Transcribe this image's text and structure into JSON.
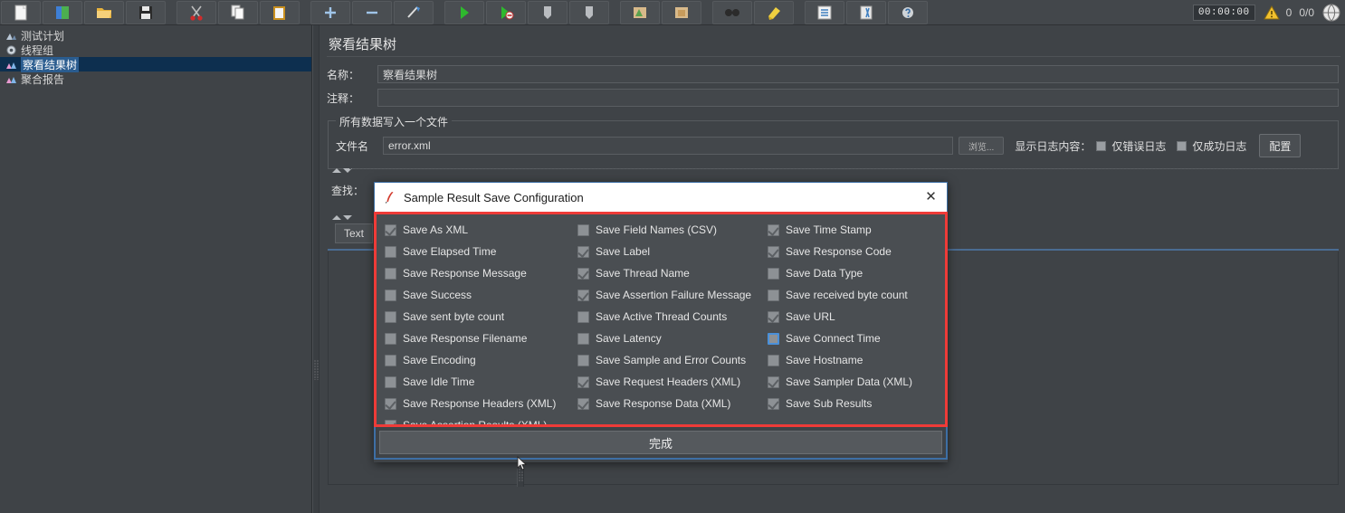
{
  "toolbar": {
    "buttons": [
      {
        "name": "new-icon",
        "label": "New"
      },
      {
        "name": "templates-icon",
        "label": "Templates"
      },
      {
        "name": "open-icon",
        "label": "Open"
      },
      {
        "name": "save-icon",
        "label": "Save"
      },
      {
        "name": "cut-icon",
        "label": "Cut"
      },
      {
        "name": "copy-icon",
        "label": "Copy"
      },
      {
        "name": "paste-icon",
        "label": "Paste"
      },
      {
        "name": "expand-all-icon",
        "label": "Expand All"
      },
      {
        "name": "collapse-all-icon",
        "label": "Collapse All"
      },
      {
        "name": "toggle-icon",
        "label": "Toggle"
      },
      {
        "name": "start-icon",
        "label": "Start"
      },
      {
        "name": "start-no-pauses-icon",
        "label": "Start no pauses"
      },
      {
        "name": "stop-icon",
        "label": "Stop"
      },
      {
        "name": "shutdown-icon",
        "label": "Shutdown"
      },
      {
        "name": "start-remote-all-icon",
        "label": "Remote Start All"
      },
      {
        "name": "stop-remote-all-icon",
        "label": "Remote Stop All"
      },
      {
        "name": "clear-icon",
        "label": "Clear"
      },
      {
        "name": "clear-all-icon",
        "label": "Clear All"
      },
      {
        "name": "search-log-icon",
        "label": "Search"
      },
      {
        "name": "function-helper-icon",
        "label": "Function Helper"
      },
      {
        "name": "help-icon",
        "label": "Help"
      }
    ],
    "timer": "00:00:00",
    "warning_count": "0",
    "thread_ratio": "0/0"
  },
  "tree": {
    "items": [
      {
        "label": "测试计划",
        "icon": "test-plan-icon",
        "indent": 0,
        "selected": false
      },
      {
        "label": "线程组",
        "icon": "thread-group-icon",
        "indent": 0,
        "selected": false
      },
      {
        "label": "察看结果树",
        "icon": "view-results-tree-icon",
        "indent": 0,
        "selected": true
      },
      {
        "label": "聚合报告",
        "icon": "aggregate-report-icon",
        "indent": 0,
        "selected": false
      }
    ]
  },
  "main": {
    "page_title": "察看结果树",
    "name_label": "名称：",
    "name_value": "察看结果树",
    "comment_label": "注释：",
    "comment_value": "",
    "group_legend": "所有数据写入一个文件",
    "filename_label": "文件名",
    "filename_value": "error.xml",
    "browse_button": "浏览...",
    "log_display_label": "显示日志内容：",
    "errors_only_label": "仅错误日志",
    "success_only_label": "仅成功日志",
    "configure_button": "配置",
    "search_label": "查找：",
    "text_button": "Text"
  },
  "dialog": {
    "title": "Sample Result Save Configuration",
    "title_icon": "jmeter-feather-icon",
    "close_icon": "close-icon",
    "done_button": "完成",
    "columns": [
      [
        {
          "label": "Save As XML",
          "checked": true,
          "focused": false
        },
        {
          "label": "Save Elapsed Time",
          "checked": false,
          "focused": false
        },
        {
          "label": "Save Response Message",
          "checked": false,
          "focused": false
        },
        {
          "label": "Save Success",
          "checked": false,
          "focused": false
        },
        {
          "label": "Save sent byte count",
          "checked": false,
          "focused": false
        },
        {
          "label": "Save Response Filename",
          "checked": false,
          "focused": false
        },
        {
          "label": "Save Encoding",
          "checked": false,
          "focused": false
        },
        {
          "label": "Save Idle Time",
          "checked": false,
          "focused": false
        },
        {
          "label": "Save Response Headers (XML)",
          "checked": true,
          "focused": false
        },
        {
          "label": "Save Assertion Results (XML)",
          "checked": true,
          "focused": false
        }
      ],
      [
        {
          "label": "Save Field Names (CSV)",
          "checked": false,
          "focused": false
        },
        {
          "label": "Save Label",
          "checked": true,
          "focused": false
        },
        {
          "label": "Save Thread Name",
          "checked": true,
          "focused": false
        },
        {
          "label": "Save Assertion Failure Message",
          "checked": true,
          "focused": false
        },
        {
          "label": "Save Active Thread Counts",
          "checked": false,
          "focused": false
        },
        {
          "label": "Save Latency",
          "checked": false,
          "focused": false
        },
        {
          "label": "Save Sample and Error Counts",
          "checked": false,
          "focused": false
        },
        {
          "label": "Save Request Headers (XML)",
          "checked": true,
          "focused": false
        },
        {
          "label": "Save Response Data (XML)",
          "checked": true,
          "focused": false
        },
        {
          "label": "",
          "checked": null,
          "focused": false
        }
      ],
      [
        {
          "label": "Save Time Stamp",
          "checked": true,
          "focused": false
        },
        {
          "label": "Save Response Code",
          "checked": true,
          "focused": false
        },
        {
          "label": "Save Data Type",
          "checked": false,
          "focused": false
        },
        {
          "label": "Save received byte count",
          "checked": false,
          "focused": false
        },
        {
          "label": "Save URL",
          "checked": true,
          "focused": false
        },
        {
          "label": "Save Connect Time",
          "checked": false,
          "focused": true
        },
        {
          "label": "Save Hostname",
          "checked": false,
          "focused": false
        },
        {
          "label": "Save Sampler Data (XML)",
          "checked": true,
          "focused": false
        },
        {
          "label": "Save Sub Results",
          "checked": true,
          "focused": false
        },
        {
          "label": "",
          "checked": null,
          "focused": false
        }
      ]
    ]
  },
  "colors": {
    "accent_red": "#ef3b38",
    "accent_blue": "#3d6fa5",
    "background": "#3f4347",
    "selection": "#2a5c8f"
  }
}
